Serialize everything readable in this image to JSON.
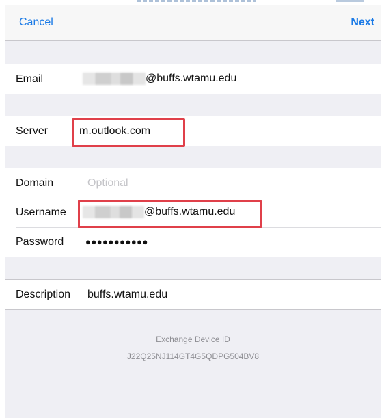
{
  "nav": {
    "cancel_label": "Cancel",
    "next_label": "Next"
  },
  "account": {
    "email_label": "Email",
    "email_value": "@buffs.wtamu.edu",
    "server_label": "Server",
    "server_value": "m.outlook.com",
    "domain_label": "Domain",
    "domain_placeholder": "Optional",
    "username_label": "Username",
    "username_value": "@buffs.wtamu.edu",
    "password_label": "Password",
    "password_value": "●●●●●●●●●●●",
    "description_label": "Description",
    "description_value": "buffs.wtamu.edu"
  },
  "footer": {
    "device_id_title": "Exchange Device ID",
    "device_id_value": "J22Q25NJ114GT4G5QDPG504BV8"
  },
  "colors": {
    "accent": "#1a7ae6",
    "highlight_box": "#e0404a",
    "grouped_background": "#efeff4"
  }
}
